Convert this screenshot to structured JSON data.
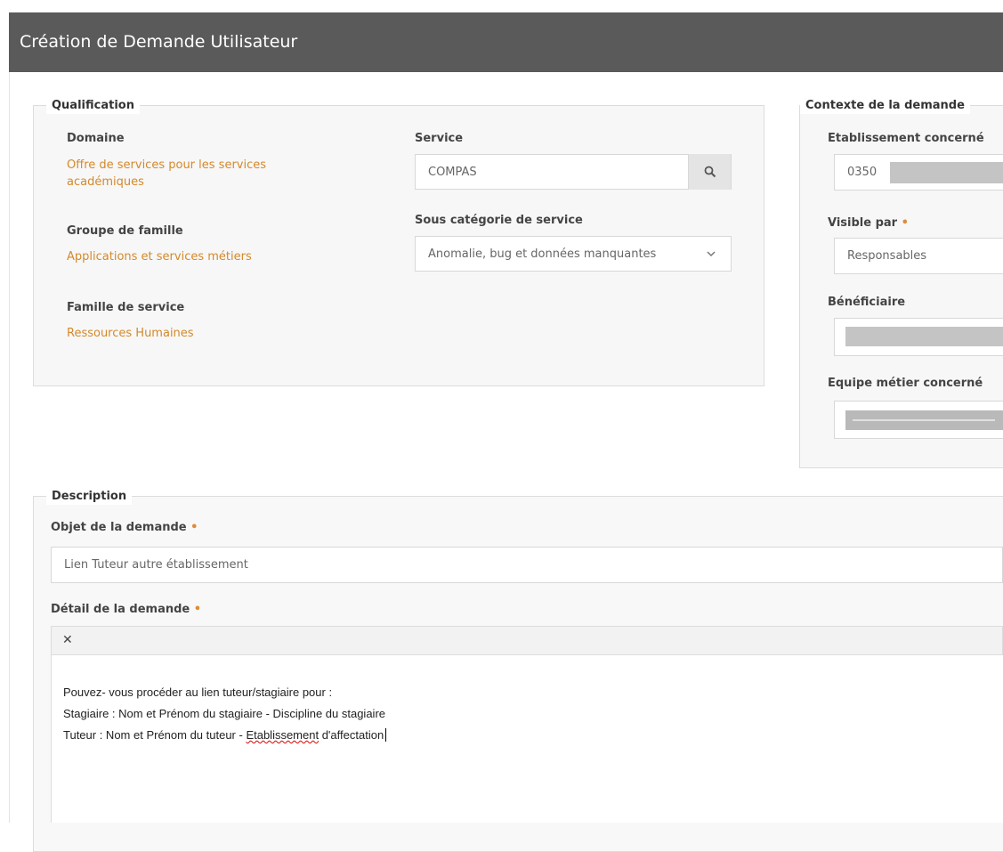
{
  "header": {
    "title": "Création de Demande Utilisateur"
  },
  "qualification": {
    "legend": "Qualification",
    "domaine_label": "Domaine",
    "domaine_value_line1": "Offre de services pour les services",
    "domaine_value_line2": "académiques",
    "groupe_label": "Groupe de famille",
    "groupe_value": "Applications et services métiers",
    "famille_label": "Famille de service",
    "famille_value": "Ressources Humaines",
    "service_label": "Service",
    "service_value": "COMPAS",
    "souscat_label": "Sous catégorie de service",
    "souscat_value": "Anomalie, bug et données manquantes"
  },
  "contexte": {
    "legend": "Contexte de la demande",
    "etab_label": "Etablissement concerné",
    "etab_value": "0350",
    "visible_label": "Visible par",
    "visible_required": "•",
    "visible_value": "Responsables",
    "beneficiaire_label": "Bénéficiaire",
    "equipe_label": "Equipe métier concerné"
  },
  "description": {
    "legend": "Description",
    "objet_label": "Objet de la demande",
    "objet_required": "•",
    "objet_value": "Lien Tuteur autre établissement",
    "detail_label": "Détail de la demande",
    "detail_required": "•",
    "toolbar_remove_icon": "✕",
    "body_line1": "Pouvez- vous procéder au lien tuteur/stagiaire pour :",
    "body_line2": "Stagiaire : Nom et Prénom du stagiaire - Discipline du stagiaire",
    "body_line3_pre": "Tuteur : Nom et Prénom du tuteur - ",
    "body_line3_spell": "Etablissement",
    "body_line3_post": " d'affectation"
  },
  "icons": {
    "search": "search-icon",
    "dropdown": "chevron-down-icon"
  },
  "colors": {
    "header_bg": "#5a5a5a",
    "link": "#d4892a",
    "required": "#e08a3a"
  }
}
